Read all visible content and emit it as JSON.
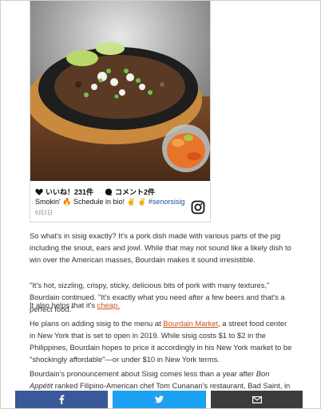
{
  "instagram": {
    "likes": "いいね！231件",
    "comments": "コメント2件",
    "caption_text": "Smokin' 🔥 Schedule in bio! ✌ ✌ ",
    "caption_tag": "#senorsisig",
    "date": "6月2日"
  },
  "article": {
    "p1": "So what's in sisig exactly? It's a pork dish made with various parts of the pig including the snout, ears and jowl. While that may not sound like a likely dish to win over the American masses, Bourdain makes it sound irresistible.",
    "p2": "\"It's hot, sizzling, crispy, sticky, delicious bits of pork with many textures,\" Bourdain continued. \"It's exactly what you need after a few beers and that's a perfect food.\"",
    "p3_before": "It also helps that it's ",
    "p3_link": "cheap.",
    "p4_before": "He plans on adding sisig to the menu at ",
    "p4_link": "Bourdain Market",
    "p4_after": ", a street food center in New York that is set to open in 2019. While sisig costs $1 to $2 in the Philippines, Bourdain hopes to price it accordingly in his New York market to be \"shockingly affordable\"—or under $10 in New York terms.",
    "p5_before": "Bourdain's pronouncement about Sisig comes less than a year after ",
    "p5_italic": "Bon Appétit",
    "p5_after": " ranked Filipino-American chef Tom Cunanan's restaurant, Bad Saint, in Washington"
  },
  "share_bar": {
    "facebook_icon": "facebook-icon",
    "twitter_icon": "twitter-icon",
    "email_icon": "email-icon",
    "colors": {
      "facebook": "#3b5998",
      "twitter": "#1da1f2",
      "email": "#3c3c3c"
    }
  }
}
